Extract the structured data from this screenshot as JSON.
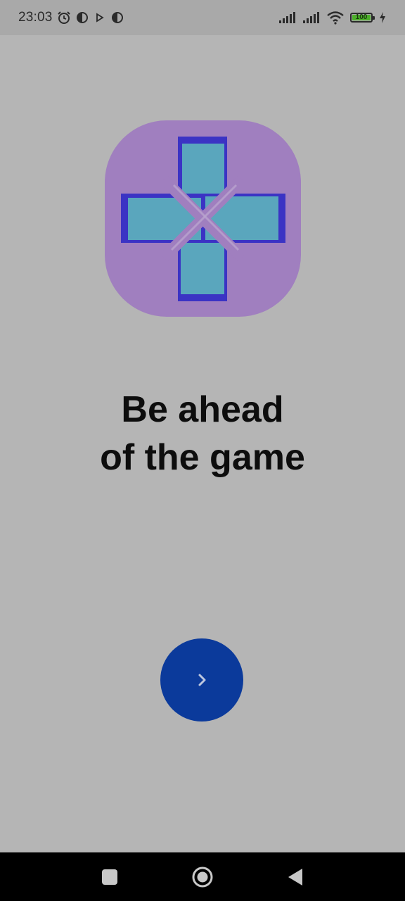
{
  "status_bar": {
    "time": "23:03",
    "battery_level": "100",
    "icons": [
      "alarm-icon",
      "app-notification-icon",
      "play-icon",
      "app-notification-icon",
      "signal-icon",
      "signal-icon",
      "wifi-icon",
      "battery-icon",
      "charging-icon"
    ]
  },
  "onboarding": {
    "logo_icon": "gamepad-dpad-icon",
    "headline_line1": "Be ahead",
    "headline_line2": "of the game",
    "next_icon": "chevron-right-icon"
  },
  "colors": {
    "background": "#b5b5b5",
    "logo_background": "#a07fbf",
    "dpad_fill": "#5aa6bd",
    "dpad_outline": "#3b33c4",
    "next_button": "#0b3a9b"
  },
  "nav_bar": {
    "buttons": [
      "recents-icon",
      "home-icon",
      "back-icon"
    ]
  }
}
